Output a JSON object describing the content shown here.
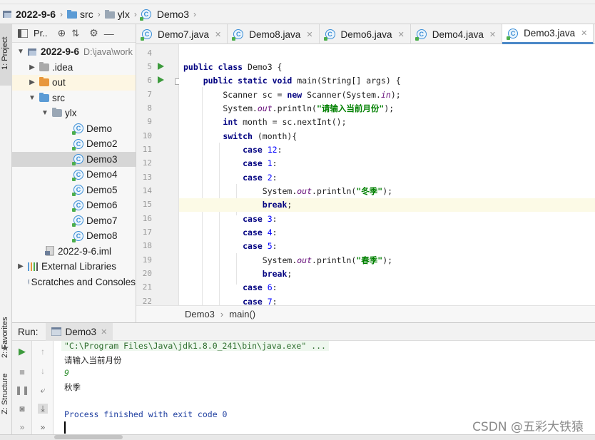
{
  "breadcrumb": [
    {
      "label": "2022-9-6",
      "icon": "project-icon"
    },
    {
      "label": "src",
      "icon": "folder-icon"
    },
    {
      "label": "ylx",
      "icon": "package-icon"
    },
    {
      "label": "Demo3",
      "icon": "class-icon"
    }
  ],
  "left_strip": {
    "project": "1: Project",
    "favorites": "2: Favorites",
    "structure": "Z: Structure"
  },
  "project_panel": {
    "title": "Pr..",
    "tree": [
      {
        "label": "2022-9-6",
        "hint": "D:\\java\\work",
        "depth": 0,
        "arrow": "down",
        "icon": "module"
      },
      {
        "label": ".idea",
        "depth": 1,
        "arrow": "right",
        "icon": "folder-gray"
      },
      {
        "label": "out",
        "depth": 1,
        "arrow": "right",
        "icon": "folder-orange"
      },
      {
        "label": "src",
        "depth": 1,
        "arrow": "down",
        "icon": "folder-blue"
      },
      {
        "label": "ylx",
        "depth": 2,
        "arrow": "down",
        "icon": "package"
      },
      {
        "label": "Demo",
        "depth": 3,
        "icon": "class"
      },
      {
        "label": "Demo2",
        "depth": 3,
        "icon": "class"
      },
      {
        "label": "Demo3",
        "depth": 3,
        "icon": "class",
        "selected": true
      },
      {
        "label": "Demo4",
        "depth": 3,
        "icon": "class"
      },
      {
        "label": "Demo5",
        "depth": 3,
        "icon": "class"
      },
      {
        "label": "Demo6",
        "depth": 3,
        "icon": "class"
      },
      {
        "label": "Demo7",
        "depth": 3,
        "icon": "class"
      },
      {
        "label": "Demo8",
        "depth": 3,
        "icon": "class"
      },
      {
        "label": "2022-9-6.iml",
        "depth": 1,
        "icon": "iml"
      },
      {
        "label": "External Libraries",
        "depth": 0,
        "arrow": "right",
        "icon": "library"
      },
      {
        "label": "Scratches and Consoles",
        "depth": 0,
        "icon": "scratch"
      }
    ]
  },
  "tabs": [
    {
      "label": "Demo7.java",
      "active": false
    },
    {
      "label": "Demo8.java",
      "active": false
    },
    {
      "label": "Demo6.java",
      "active": false
    },
    {
      "label": "Demo4.java",
      "active": false
    },
    {
      "label": "Demo3.java",
      "active": true
    }
  ],
  "code_lines": [
    {
      "n": "4",
      "text": ""
    },
    {
      "n": "5",
      "text": "public class Demo3 {"
    },
    {
      "n": "6",
      "text": "    public static void main(String[] args) {"
    },
    {
      "n": "7",
      "text": "        Scanner sc = new Scanner(System.in);"
    },
    {
      "n": "8",
      "text": "        System.out.println(\"请输入当前月份\");"
    },
    {
      "n": "9",
      "text": "        int month = sc.nextInt();"
    },
    {
      "n": "10",
      "text": "        switch (month){"
    },
    {
      "n": "11",
      "text": "            case 12:"
    },
    {
      "n": "12",
      "text": "            case 1:"
    },
    {
      "n": "13",
      "text": "            case 2:"
    },
    {
      "n": "14",
      "text": "                System.out.println(\"冬季\");"
    },
    {
      "n": "15",
      "text": "                break;"
    },
    {
      "n": "16",
      "text": "            case 3:"
    },
    {
      "n": "17",
      "text": "            case 4:"
    },
    {
      "n": "18",
      "text": "            case 5:"
    },
    {
      "n": "19",
      "text": "                System.out.println(\"春季\");"
    },
    {
      "n": "20",
      "text": "                break;"
    },
    {
      "n": "21",
      "text": "            case 6:"
    },
    {
      "n": "22",
      "text": "            case 7:"
    }
  ],
  "editor_breadcrumb": {
    "class": "Demo3",
    "method": "main()"
  },
  "run": {
    "label": "Run:",
    "tab": "Demo3",
    "console": {
      "command": "\"C:\\Program Files\\Java\\jdk1.8.0_241\\bin\\java.exe\" ...",
      "prompt": "请输入当前月份",
      "input": "9",
      "output": "秋季",
      "exit": "Process finished with exit code 0"
    }
  },
  "watermark": "CSDN @五彩大铁猿"
}
